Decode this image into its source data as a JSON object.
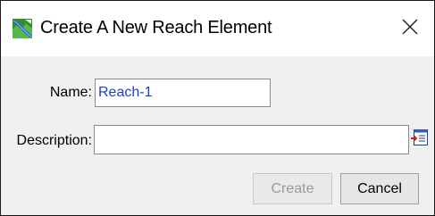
{
  "window": {
    "title": "Create A New Reach Element",
    "close_glyph": "✕",
    "app_icon": "reach-map-icon"
  },
  "form": {
    "name_label": "Name:",
    "name_value": "Reach-1",
    "description_label": "Description:",
    "description_value": "",
    "description_editor_icon": "text-editor-icon"
  },
  "buttons": {
    "create_label": "Create",
    "create_enabled": false,
    "cancel_label": "Cancel"
  },
  "colors": {
    "name_text": "#1c3fc4",
    "disabled_text": "#9a9a9a",
    "dialog_background": "#f0f0f0"
  }
}
